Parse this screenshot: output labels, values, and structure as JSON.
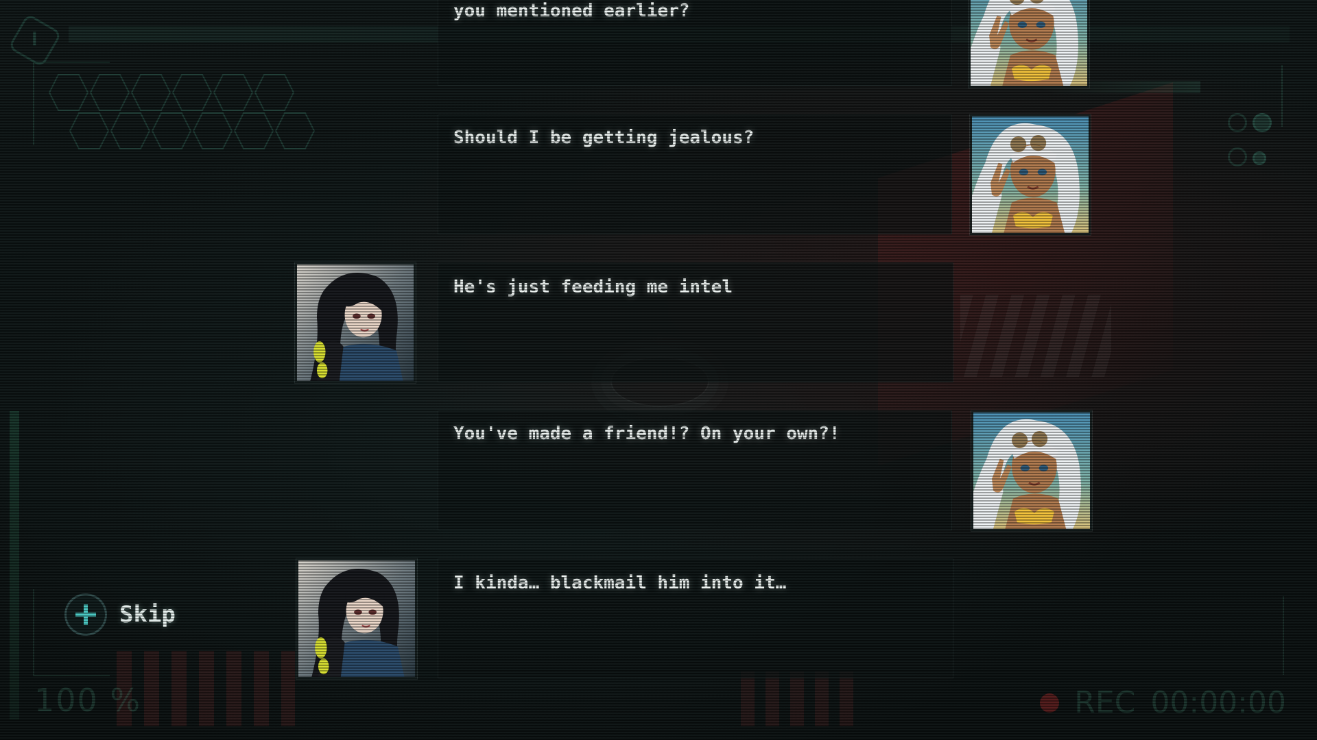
{
  "hud": {
    "zoom": "100 %",
    "rec_label": "REC",
    "rec_time": "00:00:00",
    "skip_label": "Skip",
    "icons": {
      "skip": "plus-icon",
      "badge": "hexagon-badge-icon",
      "rec": "record-dot-icon"
    }
  },
  "messages": [
    {
      "speaker": "right",
      "avatar": "white-haired-woman-avatar",
      "text": "you mentioned earlier?"
    },
    {
      "speaker": "right",
      "avatar": "white-haired-woman-avatar",
      "text": "Should I be getting jealous?"
    },
    {
      "speaker": "left",
      "avatar": "dark-haired-woman-avatar",
      "text": "He's just feeding me intel"
    },
    {
      "speaker": "right",
      "avatar": "white-haired-woman-avatar",
      "text": "You've made a friend!? On your own?!"
    },
    {
      "speaker": "left",
      "avatar": "dark-haired-woman-avatar",
      "text": "I kinda… blackmail him into it…"
    }
  ],
  "colors": {
    "accent": "#49c7c2",
    "hud_green": "#3c7864",
    "text": "#eef4f2",
    "rec": "#aa2828"
  }
}
